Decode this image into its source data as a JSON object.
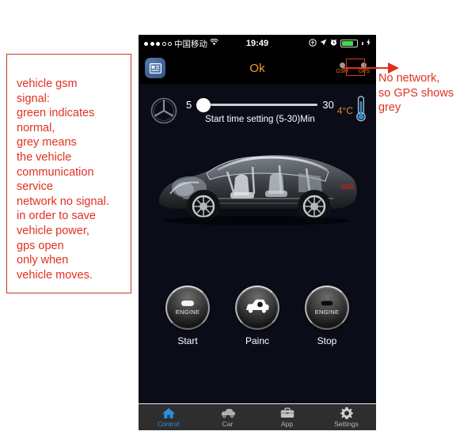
{
  "annotations": {
    "left": {
      "lines": [
        "vehicle gsm",
        "signal:",
        "green indicates",
        "normal,",
        "grey means",
        "the vehicle",
        "communication",
        "service",
        "network no signal.",
        "in order to save",
        "vehicle power,",
        "gps open",
        "only when",
        "vehicle moves."
      ]
    },
    "right": {
      "lines": [
        "No network,",
        "so GPS shows",
        "grey"
      ]
    },
    "color": "#e03020"
  },
  "statusbar": {
    "signal_filled": 3,
    "signal_empty": 2,
    "carrier": "中国移动",
    "wifi_icon": "wifi-icon",
    "time": "19:49",
    "rotation_lock_icon": "rotation-lock-icon",
    "location_icon": "location-arrow-icon",
    "alarm_icon": "alarm-clock-icon",
    "battery_icon": "battery-icon",
    "battery_level": 80,
    "battery_color": "#49d849",
    "charging_icon": "charging-bolt-icon"
  },
  "navbar": {
    "app_icon": "app-card-icon",
    "title": "Ok",
    "title_color": "#f0a020",
    "indicators": [
      {
        "label": "GSM",
        "status_color": "#9a9a9a",
        "name": "gsm-indicator"
      },
      {
        "label": "GPS",
        "status_color": "#9a9a9a",
        "name": "gps-indicator"
      }
    ],
    "indicator_label_color": "#d4761a"
  },
  "control": {
    "brand_logo": "mercedes-benz-logo",
    "slider": {
      "min_label": "5",
      "max_label": "30",
      "value": 5,
      "min": 5,
      "max": 30
    },
    "slider_caption": "Start time setting (5-30)Min",
    "temperature": "4°C",
    "temperature_color": "#d08a28",
    "thermometer_icon": "thermometer-icon",
    "car_image": "car-xray-cutaway-image"
  },
  "actions": [
    {
      "label": "Start",
      "button_text": "ENGINE",
      "icon": "engine-start-button",
      "pill_state": "on"
    },
    {
      "label": "Painc",
      "button_text": "",
      "icon": "panic-car-search-icon",
      "pill_state": "none"
    },
    {
      "label": "Stop",
      "button_text": "ENGINE",
      "icon": "engine-stop-button",
      "pill_state": "off"
    }
  ],
  "tabs": [
    {
      "label": "Control",
      "icon": "home-icon",
      "active": true
    },
    {
      "label": "Car",
      "icon": "car-icon",
      "active": false
    },
    {
      "label": "App",
      "icon": "briefcase-icon",
      "active": false
    },
    {
      "label": "Settings",
      "icon": "gear-icon",
      "active": false
    }
  ],
  "tab_active_color": "#2d8fe0",
  "tab_inactive_color": "#b8b8b8"
}
